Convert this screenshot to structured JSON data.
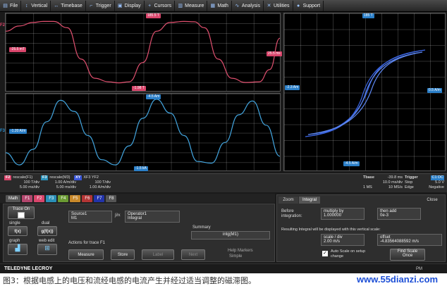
{
  "menu": [
    "File",
    "Vertical",
    "Timebase",
    "Trigger",
    "Display",
    "Cursors",
    "Measure",
    "Math",
    "Analysis",
    "Utilities",
    "Support"
  ],
  "top_grid": {
    "channel": "F2",
    "top_marker": "185.5 T",
    "left_marker": "-25.5 mT",
    "right_marker": "25.5 ms",
    "bottom_marker": "-1.98 T"
  },
  "bottom_grid": {
    "channel": "F3",
    "top_marker": "-4.5 Am",
    "left_marker": "-1.20 A/m",
    "bottom_marker": "-1.5 kA"
  },
  "xy_grid": {
    "top_marker": "185 T",
    "left_marker": "-2.3 Am",
    "right_marker": "0.5 A/m",
    "bottom_marker": "-4.5 A/m"
  },
  "traces": [
    {
      "tag": "F2",
      "name": "rescale(F1)",
      "l1": "100 T/div",
      "l2": "5.00 ms/div",
      "color": "#d9456b"
    },
    {
      "tag": "F3",
      "name": "rescale(M3)",
      "l1": "1.00 A/m/div",
      "l2": "5.00 ms/div",
      "color": "#2b7fc8"
    },
    {
      "tag": "XY",
      "name": "XF3 YF2",
      "l1": "100 T/div",
      "l2": "1.00 A/m/div",
      "color": "#3a56d8"
    }
  ],
  "timebase": {
    "label": "Tbase",
    "offset": "-39.8 ms",
    "div": "10.0 ms/div",
    "pts": "1 MS",
    "rate": "10 MS/s"
  },
  "trigger": {
    "label": "Trigger",
    "src": "C1 DC",
    "level": "5.0 V",
    "mode": "Stop",
    "edge": "Edge",
    "slope": "Negative"
  },
  "func_tabs": [
    {
      "label": "Math",
      "color": "#555555"
    },
    {
      "label": "F1",
      "color": "#b3466d"
    },
    {
      "label": "F2",
      "color": "#d9456b"
    },
    {
      "label": "F3",
      "color": "#2b90b8"
    },
    {
      "label": "F4",
      "color": "#6a9a32"
    },
    {
      "label": "F5",
      "color": "#c8882a"
    },
    {
      "label": "F6",
      "color": "#b43535"
    },
    {
      "label": "F7",
      "color": "#2233aa"
    },
    {
      "label": "F8",
      "color": "#555555"
    }
  ],
  "left_panel": {
    "trace_on": "Trace On",
    "single": "single",
    "dual": "dual",
    "single_btn": "f(x)",
    "dual_btn": "g(f(x))",
    "graph": "graph",
    "web_edit": "web edit",
    "source_label": "Source1",
    "source_value": "M1",
    "operator_label": "Operator1",
    "operator_value": "Integral",
    "summary_label": "Summary",
    "summary_value": "intg(M1)",
    "actions_label": "Actions for trace F1",
    "actions": [
      "Measure",
      "Store",
      "Label",
      "Next",
      "Help Markers"
    ],
    "simple": "Simple"
  },
  "right_panel": {
    "tabs": [
      "Zoom",
      "Integral"
    ],
    "close": "Close",
    "before_integration": "Before\nintegration:",
    "multiply_label": "multiply by",
    "multiply_value": "1.000000",
    "add_label": "then add",
    "add_value": "0e-3",
    "result_text": "Resulting Integral will be displayed with this vertical scale:",
    "scale_label": "scale / div",
    "scale_value": "2.00 m/s",
    "offset_label": "offset",
    "offset_value": "-4.83564088592 m/s",
    "auto_scale": "Auto Scale on setup change",
    "find_scale": "Find Scale",
    "find_scale_sub": "Once"
  },
  "brand": "TELEDYNE LECROY",
  "footer_time": "PM",
  "caption": "图3：根据电感上的电压和流经电感的电流产生并经过适当调整的磁滞图。",
  "watermark": "www.55dianzi.com",
  "chart_data": {
    "type": "line",
    "series": [
      {
        "name": "F2",
        "color": "#e0506f",
        "x": [
          0,
          2,
          4,
          5.5,
          7,
          9,
          11,
          13,
          15,
          16.5,
          18,
          20,
          22,
          24,
          26,
          27.5,
          29,
          31,
          33,
          35,
          37,
          38.5,
          40
        ],
        "y": [
          0.6,
          0.75,
          0.85,
          0.88,
          0.88,
          0.7,
          -0.2,
          -0.75,
          -0.85,
          -0.88,
          -0.85,
          -0.3,
          0.6,
          0.85,
          0.88,
          0.87,
          0.7,
          -0.2,
          -0.75,
          -0.87,
          -0.85,
          -0.5,
          0.4
        ]
      },
      {
        "name": "F3",
        "color": "#43a6e0",
        "x": [
          0,
          2,
          4,
          6,
          8,
          10,
          12,
          14,
          16,
          18,
          20,
          22,
          24,
          26,
          28,
          30,
          32,
          34,
          36,
          38,
          40
        ],
        "y": [
          -0.6,
          -0.95,
          -0.5,
          0.3,
          0.92,
          0.6,
          -0.1,
          -0.8,
          -0.95,
          -0.4,
          0.4,
          0.95,
          0.55,
          -0.1,
          -0.85,
          -0.9,
          -0.3,
          0.5,
          0.9,
          0.2,
          -0.7
        ]
      }
    ]
  }
}
